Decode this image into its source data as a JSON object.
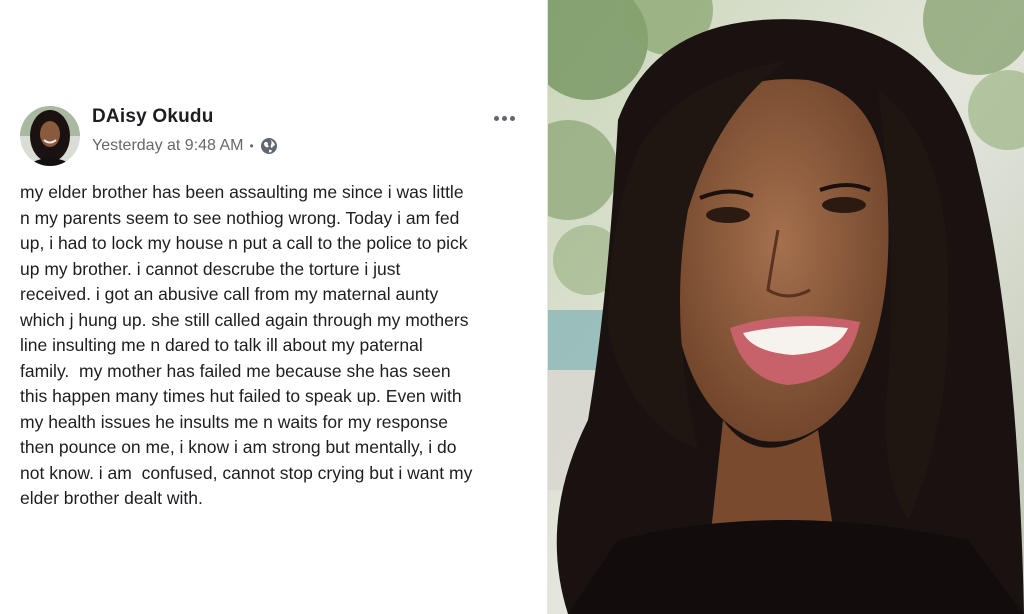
{
  "post": {
    "author_name": "DAisy Okudu",
    "timestamp": "Yesterday at 9:48 AM",
    "separator": "•",
    "privacy_icon": "globe-icon",
    "more_icon": "more-options-icon",
    "text_lines": [
      "my elder brother has been assaulting me since i was little",
      "n my parents seem to see nothiog wrong. Today i am fed",
      "up, i had to lock my house n put a call to the police to pick",
      "up my brother. i cannot descrube the torture i just",
      "received. i got an abusive call from my maternal aunty",
      "which j hung up. she still called again through my mothers",
      "line insulting me n dared to talk ill about my paternal",
      "family.  my mother has failed me because she has seen",
      "this happen many times hut failed to speak up. Even with",
      "my health issues he insults me n waits for my response",
      "then pounce on me, i know i am strong but mentally, i do",
      "not know. i am  confused, cannot stop crying but i want my",
      "elder brother dealt with."
    ]
  },
  "colors": {
    "name": "#1c1e21",
    "meta": "#65676b",
    "hair": "#1a1210",
    "skin": "#8a5a3c",
    "lips": "#c8626a",
    "foliage": "#6f8f5a"
  }
}
